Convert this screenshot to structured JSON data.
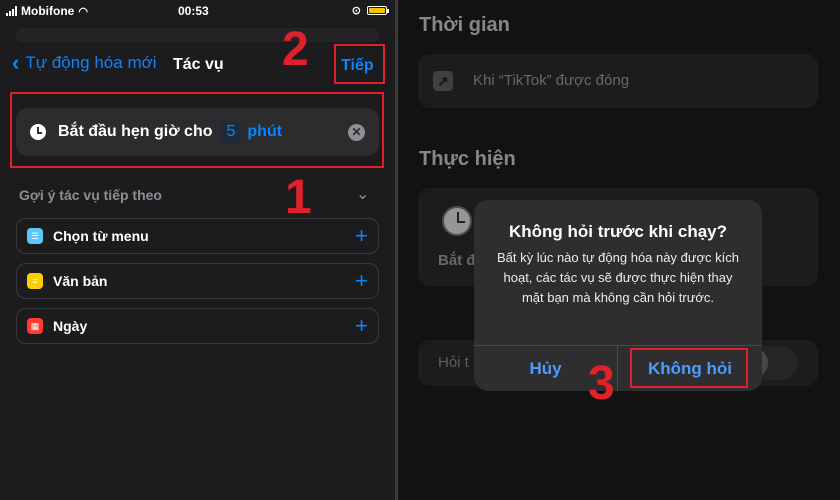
{
  "status_bar": {
    "carrier": "Mobifone",
    "time": "00:53"
  },
  "left": {
    "back_label": "Tự động hóa mới",
    "title": "Tác vụ",
    "next_label": "Tiếp",
    "action": {
      "text": "Bắt đầu hẹn giờ cho",
      "value": "5",
      "unit": "phút"
    },
    "suggestions_title": "Gợi ý tác vụ tiếp theo",
    "suggestions": [
      {
        "label": "Chọn từ menu",
        "icon": "menu-icon",
        "color": "#5ac8fa"
      },
      {
        "label": "Văn bản",
        "icon": "text-icon",
        "color": "#ffcc00"
      },
      {
        "label": "Ngày",
        "icon": "calendar-icon",
        "color": "#ff3b30"
      }
    ]
  },
  "right": {
    "section_time": "Thời gian",
    "trigger_text": "Khi “TikTok” được đóng",
    "section_do": "Thực hiện",
    "action_partial": "Bắt đ",
    "ask_partial": "Hỏi t"
  },
  "alert": {
    "title": "Không hỏi trước khi chạy?",
    "message": "Bất kỳ lúc nào tự động hóa này được kích hoạt, các tác vụ sẽ được thực hiện thay mặt bạn mà không cần hỏi trước.",
    "cancel_label": "Hủy",
    "confirm_label": "Không hỏi"
  },
  "annotations": {
    "n1": "1",
    "n2": "2",
    "n3": "3"
  },
  "colors": {
    "accent": "#0a84ff",
    "annotation": "#e0202a"
  }
}
